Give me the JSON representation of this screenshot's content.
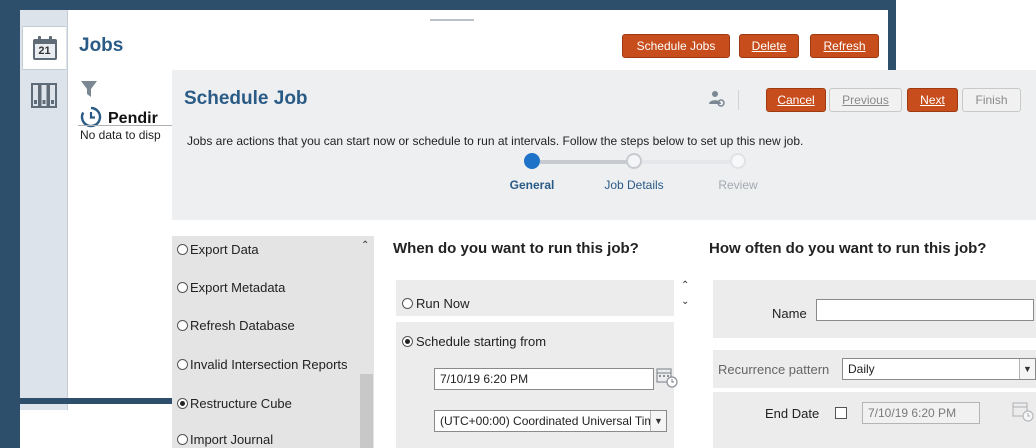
{
  "jobs_page": {
    "title": "Jobs",
    "calendar_day": "21",
    "buttons": {
      "schedule_jobs": "Schedule Jobs",
      "delete": "Delete",
      "refresh": "Refresh"
    },
    "pending_title": "Pendir",
    "no_data": "No data to disp"
  },
  "dialog": {
    "title": "Schedule Job",
    "description": "Jobs are actions that you can start now or schedule to run at intervals. Follow the steps below to set up this new job.",
    "buttons": {
      "cancel": "Cancel",
      "previous": "Previous",
      "next": "Next",
      "finish": "Finish"
    },
    "steps": [
      {
        "label": "General",
        "state": "current"
      },
      {
        "label": "Job Details",
        "state": "upcoming"
      },
      {
        "label": "Review",
        "state": "disabled"
      }
    ],
    "job_types": [
      {
        "label": "Export Data",
        "selected": false
      },
      {
        "label": "Export Metadata",
        "selected": false
      },
      {
        "label": "Refresh Database",
        "selected": false
      },
      {
        "label": "Invalid Intersection Reports",
        "selected": false
      },
      {
        "label": "Restructure Cube",
        "selected": true
      },
      {
        "label": "Import Journal",
        "selected": false
      }
    ],
    "when": {
      "heading": "When do you want to run this job?",
      "run_now": "Run Now",
      "schedule_starting_from": "Schedule starting from",
      "start_datetime": "7/10/19 6:20 PM",
      "timezone": "(UTC+00:00) Coordinated Universal Tim"
    },
    "how_often": {
      "heading": "How often do you want to run this job?",
      "name_label": "Name",
      "name_value": "",
      "recurrence_label": "Recurrence pattern",
      "recurrence_value": "Daily",
      "end_date_label": "End Date",
      "end_date_value": "7/10/19 6:20 PM"
    }
  },
  "colors": {
    "accent": "#c74d1c",
    "title_blue": "#2a5b86",
    "navy": "#2e4f6c",
    "step_active": "#1e72c8"
  },
  "icons": [
    "calendar-icon",
    "library-icon",
    "filter-icon",
    "clock-icon",
    "user-settings-icon",
    "calendar-picker-icon"
  ]
}
